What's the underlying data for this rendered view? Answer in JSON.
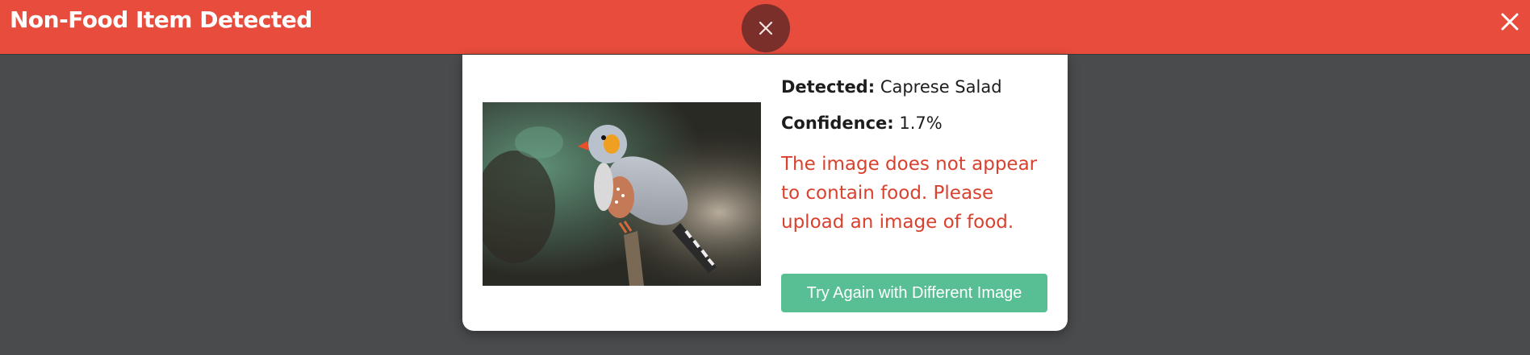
{
  "header": {
    "title": "Non-Food Item Detected",
    "close_icon": "close-icon"
  },
  "overlay_close": {
    "icon": "close-icon"
  },
  "result": {
    "detected_label": "Detected:",
    "detected_value": "Caprese Salad",
    "confidence_label": "Confidence:",
    "confidence_value": "1.7%",
    "message": "The image does not appear to contain food. Please upload an image of food."
  },
  "actions": {
    "retry_label": "Try Again with Different Image"
  },
  "colors": {
    "header": "#e84c3d",
    "message": "#d9412f",
    "button": "#58bf94",
    "backdrop": "#4a4b4d"
  }
}
